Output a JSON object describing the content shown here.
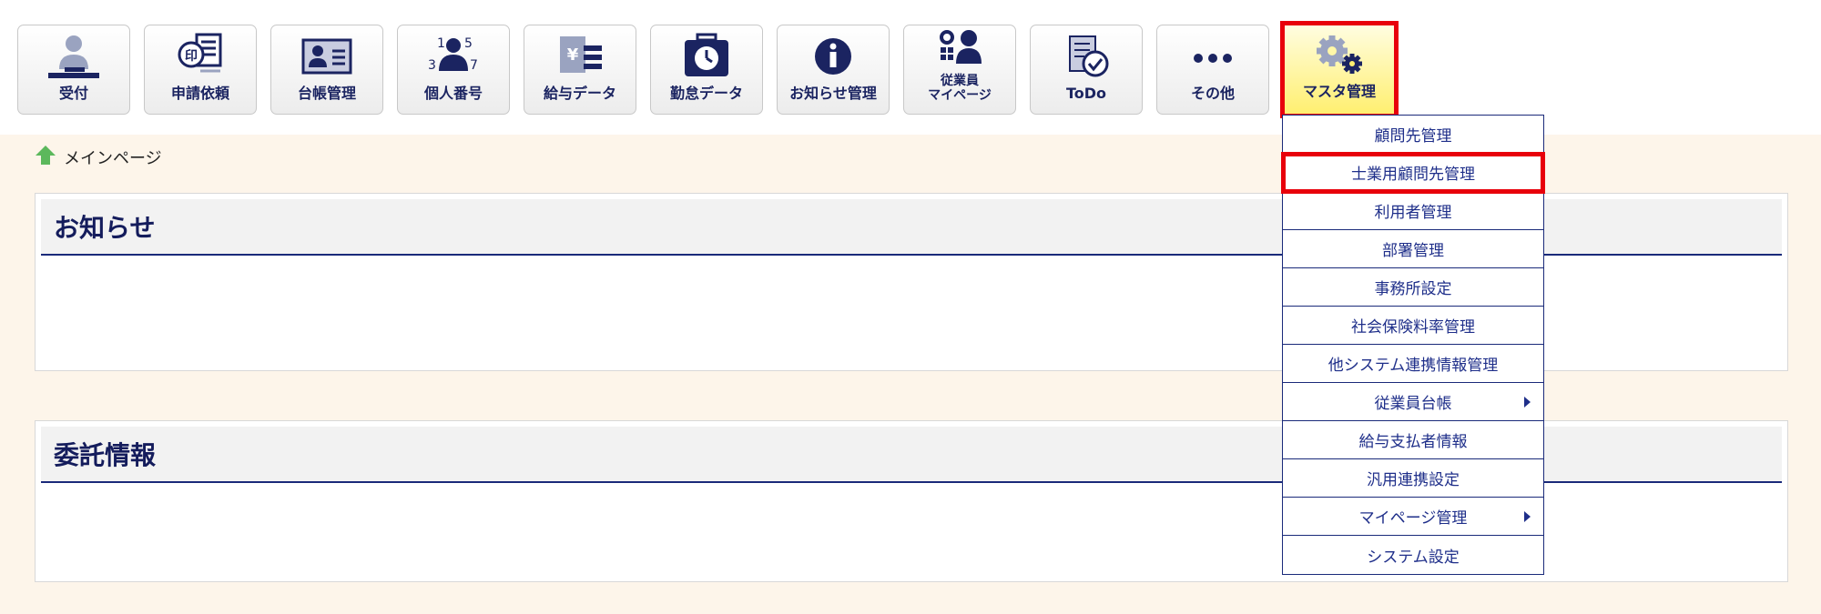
{
  "toolbar": {
    "items": [
      {
        "label": "受付",
        "icon": "reception-icon"
      },
      {
        "label": "申請依頼",
        "icon": "stamp-document-icon"
      },
      {
        "label": "台帳管理",
        "icon": "id-card-icon"
      },
      {
        "label": "個人番号",
        "icon": "person-number-icon"
      },
      {
        "label": "給与データ",
        "icon": "salary-data-icon"
      },
      {
        "label": "勤怠データ",
        "icon": "attendance-clock-icon"
      },
      {
        "label": "お知らせ管理",
        "icon": "info-icon"
      },
      {
        "label_line1": "従業員",
        "label_line2": "マイページ",
        "icon": "employee-mypage-icon"
      },
      {
        "label": "ToDo",
        "icon": "todo-check-icon"
      },
      {
        "label": "その他",
        "icon": "more-dots-icon"
      },
      {
        "label": "マスタ管理",
        "icon": "gears-icon"
      }
    ]
  },
  "breadcrumb": {
    "label": "メインページ",
    "icon": "home-arrow-icon"
  },
  "panels": [
    {
      "title": "お知らせ"
    },
    {
      "title": "委託情報"
    }
  ],
  "dropdown": {
    "items": [
      {
        "label": "顧問先管理"
      },
      {
        "label": "士業用顧問先管理"
      },
      {
        "label": "利用者管理"
      },
      {
        "label": "部署管理"
      },
      {
        "label": "事務所設定"
      },
      {
        "label": "社会保険料率管理"
      },
      {
        "label": "他システム連携情報管理"
      },
      {
        "label": "従業員台帳"
      },
      {
        "label": "給与支払者情報"
      },
      {
        "label": "汎用連携設定"
      },
      {
        "label": "マイページ管理"
      },
      {
        "label": "システム設定"
      }
    ]
  },
  "colors": {
    "navy": "#1a2a7a",
    "highlight_red": "#e8000b",
    "active_yellow": "#ffef70",
    "content_bg": "#fdf5ea",
    "home_green": "#5cb85c"
  }
}
